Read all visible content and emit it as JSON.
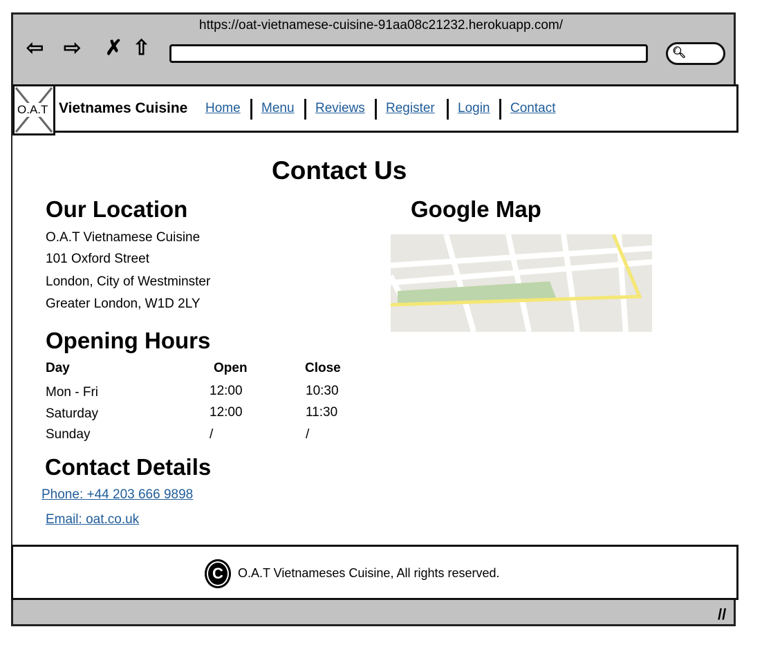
{
  "browser": {
    "url": "https://oat-vietnamese-cuisine-91aa08c21232.herokuapp.com/"
  },
  "navbar": {
    "logo_text": "O.A.T",
    "brand": "Vietnames Cuisine",
    "links": [
      "Home",
      "Menu",
      "Reviews",
      "Register",
      "Login",
      "Contact"
    ]
  },
  "main": {
    "title": "Contact Us",
    "location": {
      "heading": "Our Location",
      "lines": [
        "O.A.T Vietnamese Cuisine",
        "101 Oxford Street",
        "London, City of Westminster",
        "Greater London, W1D 2LY"
      ]
    },
    "map": {
      "heading": "Google Map"
    },
    "hours": {
      "heading": "Opening Hours",
      "columns": [
        "Day",
        "Open",
        "Close"
      ],
      "rows": [
        [
          "Mon - Fri",
          "12:00",
          "10:30"
        ],
        [
          "Saturday",
          "12:00",
          "11:30"
        ],
        [
          "Sunday",
          "/",
          "/"
        ]
      ]
    },
    "contact": {
      "heading": "Contact Details",
      "phone": "Phone: +44 203 666 9898",
      "email": "Email: oat.co.uk"
    }
  },
  "footer": {
    "text": "O.A.T Vietnameses Cuisine, All rights reserved."
  },
  "colors": {
    "link": "#1f5c99",
    "chrome": "#c2c2c2"
  }
}
